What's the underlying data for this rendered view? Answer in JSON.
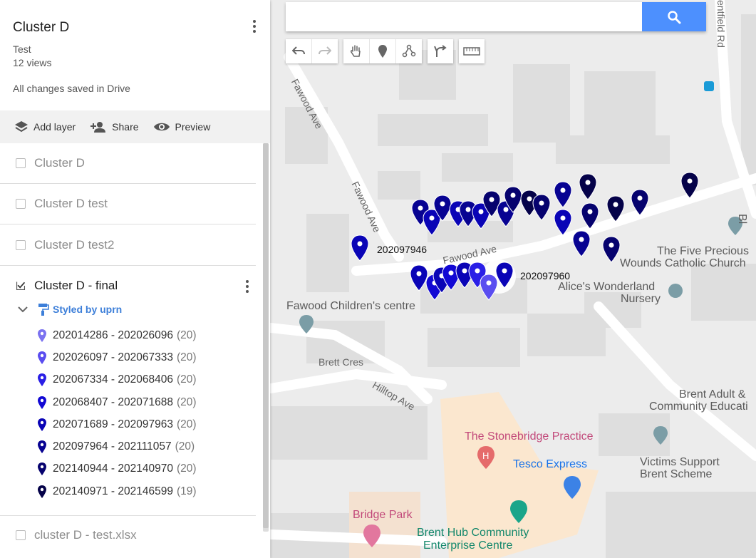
{
  "panel": {
    "title": "Cluster D",
    "description": "Test",
    "views": "12 views",
    "saved_status": "All changes saved in Drive",
    "toolbar": {
      "add_layer": "Add layer",
      "share": "Share",
      "preview": "Preview"
    }
  },
  "layers": [
    {
      "name": "Cluster D",
      "checked": false
    },
    {
      "name": "Cluster D test",
      "checked": false
    },
    {
      "name": "Cluster D test2",
      "checked": false
    },
    {
      "name": "Cluster D - final",
      "checked": true,
      "style_label": "Styled by uprn",
      "legend": [
        {
          "range": "202014286 - 202026096",
          "count": "(20)",
          "color": "#7b72f0"
        },
        {
          "range": "202026097 - 202067333",
          "count": "(20)",
          "color": "#5a4df0"
        },
        {
          "range": "202067334 - 202068406",
          "count": "(20)",
          "color": "#2a1fe6"
        },
        {
          "range": "202068407 - 202071688",
          "count": "(20)",
          "color": "#1208d4"
        },
        {
          "range": "202071689 - 202097963",
          "count": "(20)",
          "color": "#0a04b6"
        },
        {
          "range": "202097964 - 202111057",
          "count": "(20)",
          "color": "#080392"
        },
        {
          "range": "202140944 - 202140970",
          "count": "(20)",
          "color": "#06026e"
        },
        {
          "range": "202140971 - 202146599",
          "count": "(19)",
          "color": "#050249"
        }
      ]
    },
    {
      "name": "cluster D - test.xlsx",
      "checked": false
    }
  ],
  "search": {
    "placeholder": ""
  },
  "map": {
    "roads": [
      "Fawood Ave",
      "Fawood Ave",
      "Fawood Ave",
      "Brett Cres",
      "Hilltop Ave",
      "entfield Rd"
    ],
    "pois": [
      "Fawood Children's centre",
      "The Five Precious",
      "Wounds Catholic Church",
      "Alice's Wonderland",
      "Nursery",
      "Brent Adult &",
      "Community Educati",
      "Victims Support",
      "Brent Scheme",
      "The Stonebridge Practice",
      "Tesco Express",
      "Bridge Park",
      "Brent Hub Community",
      "Enterprise Centre",
      "Bl"
    ],
    "uprn_labels": [
      "202097946",
      "202097960"
    ]
  },
  "colors": {
    "accent": "#4d90fe",
    "marker_dark": "#0a04b6"
  }
}
